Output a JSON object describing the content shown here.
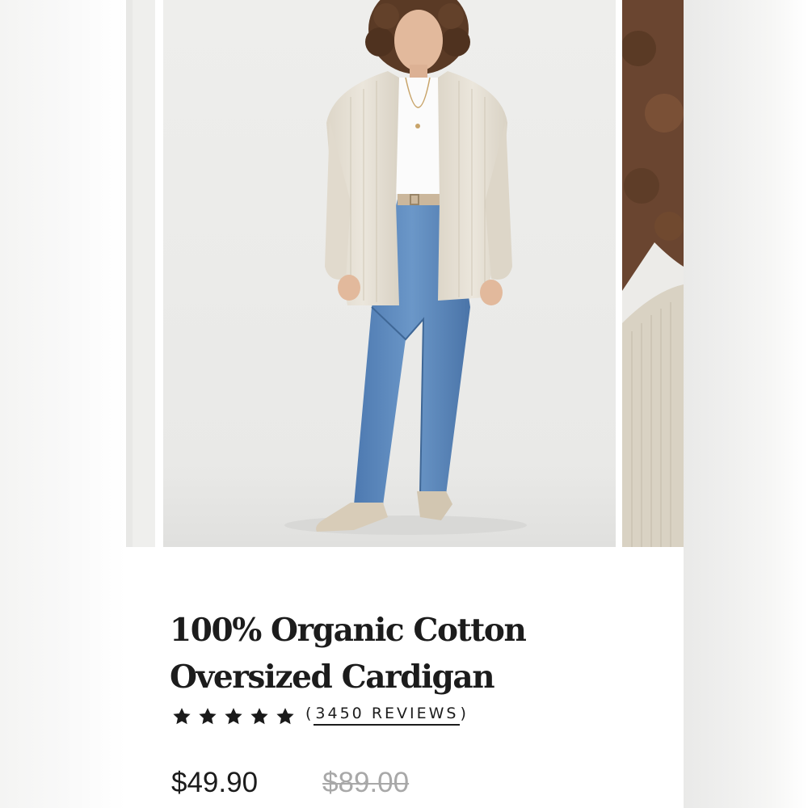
{
  "product": {
    "title": "100% Organic Cotton Oversized Cardigan",
    "rating": {
      "stars": 5,
      "max_stars": 5,
      "open_paren": "(",
      "count_label": "3450 REVIEWS",
      "close_paren": ")"
    },
    "price": "$49.90",
    "compare_at_price": "$89.00"
  },
  "gallery": {
    "images": [
      {
        "name": "previous-product-image"
      },
      {
        "name": "model-front-view"
      },
      {
        "name": "cardigan-knit-detail"
      }
    ],
    "active_index": 1
  },
  "colors": {
    "text": "#1c1c1c",
    "muted": "#a8a8a8",
    "star": "#1a1a1a"
  }
}
